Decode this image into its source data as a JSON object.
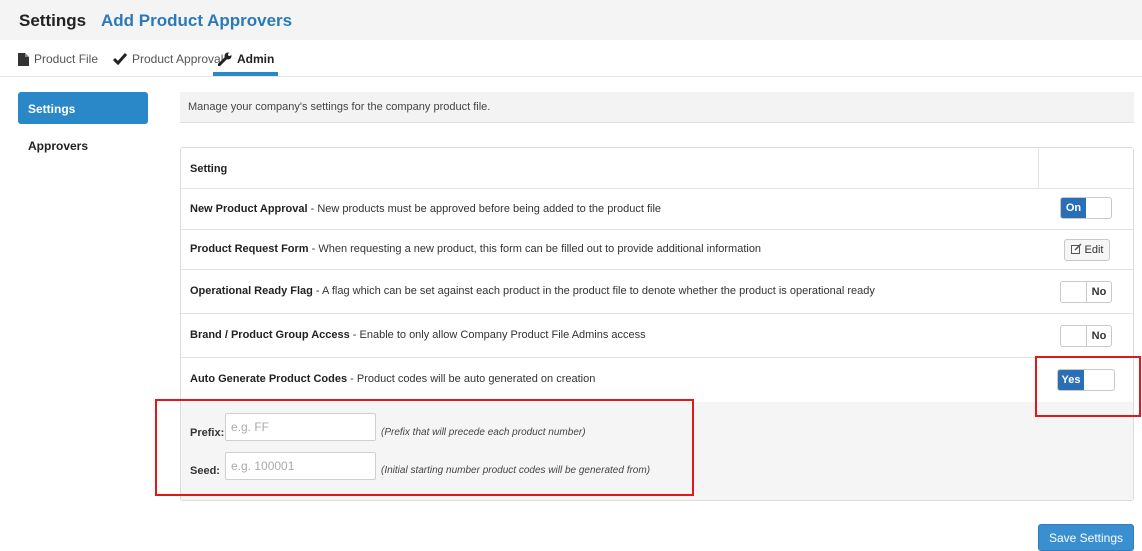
{
  "header": {
    "title": "Settings",
    "subtitle": "Add Product Approvers"
  },
  "nav": {
    "tabs": [
      {
        "label": "Product File",
        "icon": "file-icon"
      },
      {
        "label": "Product Approval",
        "icon": "check-icon"
      },
      {
        "label": "Admin",
        "icon": "wrench-icon",
        "active": true
      }
    ],
    "accent_color": "#2a88c8"
  },
  "sidebar": {
    "items": [
      {
        "label": "Settings",
        "active": true
      },
      {
        "label": "Approvers"
      }
    ]
  },
  "main": {
    "intro": "Manage your company's settings for the company product file.",
    "table_header": "Setting",
    "rows": [
      {
        "name": "New Product Approval",
        "desc": " - New products must be approved before being added to the product file",
        "control": "toggle",
        "value": "On"
      },
      {
        "name": "Product Request Form",
        "desc": " - When requesting a new product, this form can be filled out to provide additional information",
        "control": "button",
        "value": "Edit"
      },
      {
        "name": "Operational Ready Flag",
        "desc": " - A flag which can be set against each product in the product file to denote whether the product is operational ready",
        "control": "toggle",
        "value": "No"
      },
      {
        "name": "Brand / Product Group Access",
        "desc": " - Enable to only allow Company Product File Admins access",
        "control": "toggle",
        "value": "No"
      },
      {
        "name": "Auto Generate Product Codes",
        "desc": " - Product codes will be auto generated on creation",
        "control": "toggle",
        "value": "Yes"
      }
    ],
    "prefix": {
      "label": "Prefix:",
      "placeholder": "e.g. FF",
      "help": "(Prefix that will precede each product number)"
    },
    "seed": {
      "label": "Seed:",
      "placeholder": "e.g. 100001",
      "help": "(Initial starting number product codes will be generated from)"
    },
    "save_label": "Save Settings"
  },
  "colors": {
    "toggle_on": "#2a6fb5",
    "highlight_box": "#e01818"
  }
}
